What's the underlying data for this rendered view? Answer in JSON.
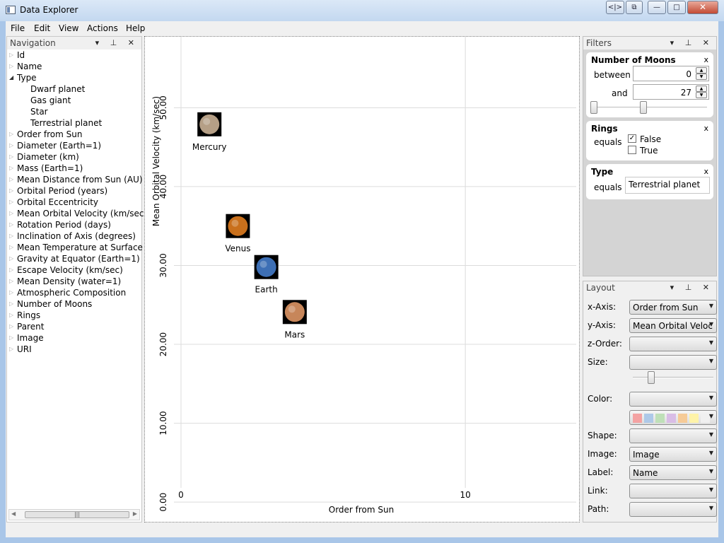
{
  "window": {
    "title": "Data Explorer",
    "btn_restore": "<|>",
    "btn_copy": "⧉",
    "btn_minimize": "—",
    "btn_maximize": "□",
    "btn_close": "✕"
  },
  "menu": [
    "File",
    "Edit",
    "View",
    "Actions",
    "Help"
  ],
  "navigation": {
    "title": "Navigation",
    "header_icons": "▾ ⊥ ✕",
    "items": [
      {
        "label": "Id",
        "level": 0,
        "expanded": false
      },
      {
        "label": "Name",
        "level": 0,
        "expanded": false
      },
      {
        "label": "Type",
        "level": 0,
        "expanded": true
      },
      {
        "label": "Dwarf planet",
        "level": 1,
        "expanded": false
      },
      {
        "label": "Gas giant",
        "level": 1,
        "expanded": false
      },
      {
        "label": "Star",
        "level": 1,
        "expanded": false
      },
      {
        "label": "Terrestrial planet",
        "level": 1,
        "expanded": false
      },
      {
        "label": "Order from Sun",
        "level": 0,
        "expanded": false
      },
      {
        "label": "Diameter (Earth=1)",
        "level": 0,
        "expanded": false
      },
      {
        "label": "Diameter (km)",
        "level": 0,
        "expanded": false
      },
      {
        "label": "Mass (Earth=1)",
        "level": 0,
        "expanded": false
      },
      {
        "label": "Mean Distance from Sun (AU)",
        "level": 0,
        "expanded": false
      },
      {
        "label": "Orbital Period (years)",
        "level": 0,
        "expanded": false
      },
      {
        "label": "Orbital Eccentricity",
        "level": 0,
        "expanded": false
      },
      {
        "label": "Mean Orbital Velocity (km/sec)",
        "level": 0,
        "expanded": false
      },
      {
        "label": "Rotation Period (days)",
        "level": 0,
        "expanded": false
      },
      {
        "label": "Inclination of Axis (degrees)",
        "level": 0,
        "expanded": false
      },
      {
        "label": "Mean Temperature at Surface (C)",
        "level": 0,
        "expanded": false
      },
      {
        "label": "Gravity at Equator (Earth=1)",
        "level": 0,
        "expanded": false
      },
      {
        "label": "Escape Velocity (km/sec)",
        "level": 0,
        "expanded": false
      },
      {
        "label": "Mean Density (water=1)",
        "level": 0,
        "expanded": false
      },
      {
        "label": "Atmospheric Composition",
        "level": 0,
        "expanded": false
      },
      {
        "label": "Number of Moons",
        "level": 0,
        "expanded": false
      },
      {
        "label": "Rings",
        "level": 0,
        "expanded": false
      },
      {
        "label": "Parent",
        "level": 0,
        "expanded": false
      },
      {
        "label": "Image",
        "level": 0,
        "expanded": false
      },
      {
        "label": "URI",
        "level": 0,
        "expanded": false
      }
    ]
  },
  "chart_data": {
    "type": "scatter",
    "xlabel": "Order from Sun",
    "ylabel": "Mean Orbital Velocity (km/sec)",
    "xlim": [
      0,
      14
    ],
    "ylim": [
      -2.5,
      59
    ],
    "x_ticks": [
      0,
      10
    ],
    "x_tick_labels": [
      "0",
      "10"
    ],
    "y_ticks": [
      0,
      10,
      20,
      30,
      40,
      50
    ],
    "y_tick_labels": [
      "0.00",
      "10.00",
      "20.00",
      "30.00",
      "40.00",
      "50.00"
    ],
    "grid": true,
    "points": [
      {
        "label": "Mercury",
        "x": 1,
        "y": 47.9,
        "color": "#b59f86"
      },
      {
        "label": "Venus",
        "x": 2,
        "y": 35.0,
        "color": "#c9701c"
      },
      {
        "label": "Earth",
        "x": 3,
        "y": 29.8,
        "color": "#3d6fb5"
      },
      {
        "label": "Mars",
        "x": 4,
        "y": 24.1,
        "color": "#c7865a"
      }
    ]
  },
  "filters": {
    "title": "Filters",
    "header_icons": "▾ ⊥ ✕",
    "moons": {
      "title": "Number of Moons",
      "close": "x",
      "between_label": "between",
      "and_label": "and",
      "min_value": "0",
      "max_value": "27",
      "slider_range": 0.45
    },
    "rings": {
      "title": "Rings",
      "close": "x",
      "equals_label": "equals",
      "options": [
        {
          "label": "False",
          "checked": true
        },
        {
          "label": "True",
          "checked": false
        }
      ]
    },
    "type": {
      "title": "Type",
      "close": "x",
      "equals_label": "equals",
      "value": "Terrestrial planet"
    }
  },
  "layout": {
    "title": "Layout",
    "header_icons": "▾ ⊥ ✕",
    "rows": [
      {
        "label": "x-Axis:",
        "value": "Order from Sun"
      },
      {
        "label": "y-Axis:",
        "value": "Mean Orbital Veloc"
      },
      {
        "label": "z-Order:",
        "value": ""
      },
      {
        "label": "Size:",
        "value": ""
      },
      {
        "label": "Color:",
        "value": ""
      },
      {
        "label": "Shape:",
        "value": ""
      },
      {
        "label": "Image:",
        "value": "Image"
      },
      {
        "label": "Label:",
        "value": "Name"
      },
      {
        "label": "Link:",
        "value": ""
      },
      {
        "label": "Path:",
        "value": ""
      }
    ],
    "size_slider_value": 0.2,
    "palette": [
      "#f4a3a3",
      "#aec9e8",
      "#bfe0b8",
      "#d9bde6",
      "#f6cb97",
      "#fff3a8",
      "#f0f0f0"
    ]
  }
}
